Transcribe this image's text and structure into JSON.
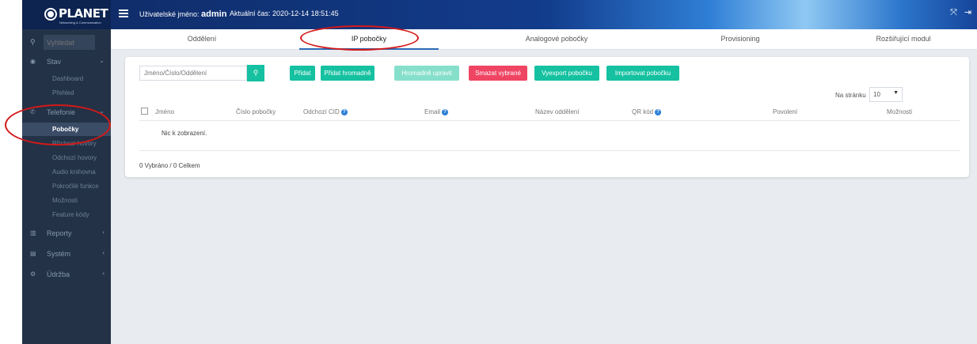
{
  "header": {
    "logo": "PLANET",
    "logo_sub": "Networking & Communication",
    "user_prefix": "Uživatelské jméno:",
    "username": "admin",
    "time_prefix": "Aktuální čas:",
    "time_value": "2020-12-14 18:51:45",
    "icons": [
      "fullscreen-icon",
      "logout-icon"
    ]
  },
  "sidebar": {
    "search_placeholder": "Vyhledat",
    "groups": [
      {
        "label": "Stav",
        "icon": "dashboard-icon"
      },
      {
        "label": "Telefonie",
        "icon": "phone-icon"
      },
      {
        "label": "Reporty",
        "icon": "chart-icon"
      },
      {
        "label": "Systém",
        "icon": "system-icon"
      },
      {
        "label": "Údržba",
        "icon": "gear-icon"
      }
    ],
    "stav_items": [
      "Dashboard",
      "Přehled"
    ],
    "telefonie_items": [
      "Pobočky",
      "Příchozí hovory",
      "Odchozí hovory",
      "Audio knihovna",
      "Pokročilé funkce",
      "Možnosti",
      "Feature kódy"
    ],
    "active_item": "Pobočky"
  },
  "tabs": [
    "Oddělení",
    "IP pobočky",
    "Analogové pobočky",
    "Provisioning",
    "Rozšiřující modul"
  ],
  "active_tab": "IP pobočky",
  "toolbar": {
    "filter_placeholder": "Jméno/Číslo/Oddělení",
    "buttons": [
      "Přidat",
      "Přidat hromadně",
      "Hromadně upravit",
      "Smazat vybrané",
      "Vyexport pobočku",
      "Importovat pobočku"
    ]
  },
  "pagination": {
    "label": "Na stránku",
    "value": "10"
  },
  "table": {
    "columns": [
      "Jméno",
      "Číslo pobočky",
      "Odchozí CID",
      "Email",
      "Název oddělení",
      "QR kód",
      "Povolení",
      "Možnosti"
    ],
    "empty_text": "Nic k zobrazení.",
    "summary": "0 Vybráno / 0 Celkem"
  },
  "colors": {
    "accent": "#15c1a0",
    "danger": "#ef4563",
    "sidebar_bg": "#233246",
    "annotation": "#d41919"
  }
}
